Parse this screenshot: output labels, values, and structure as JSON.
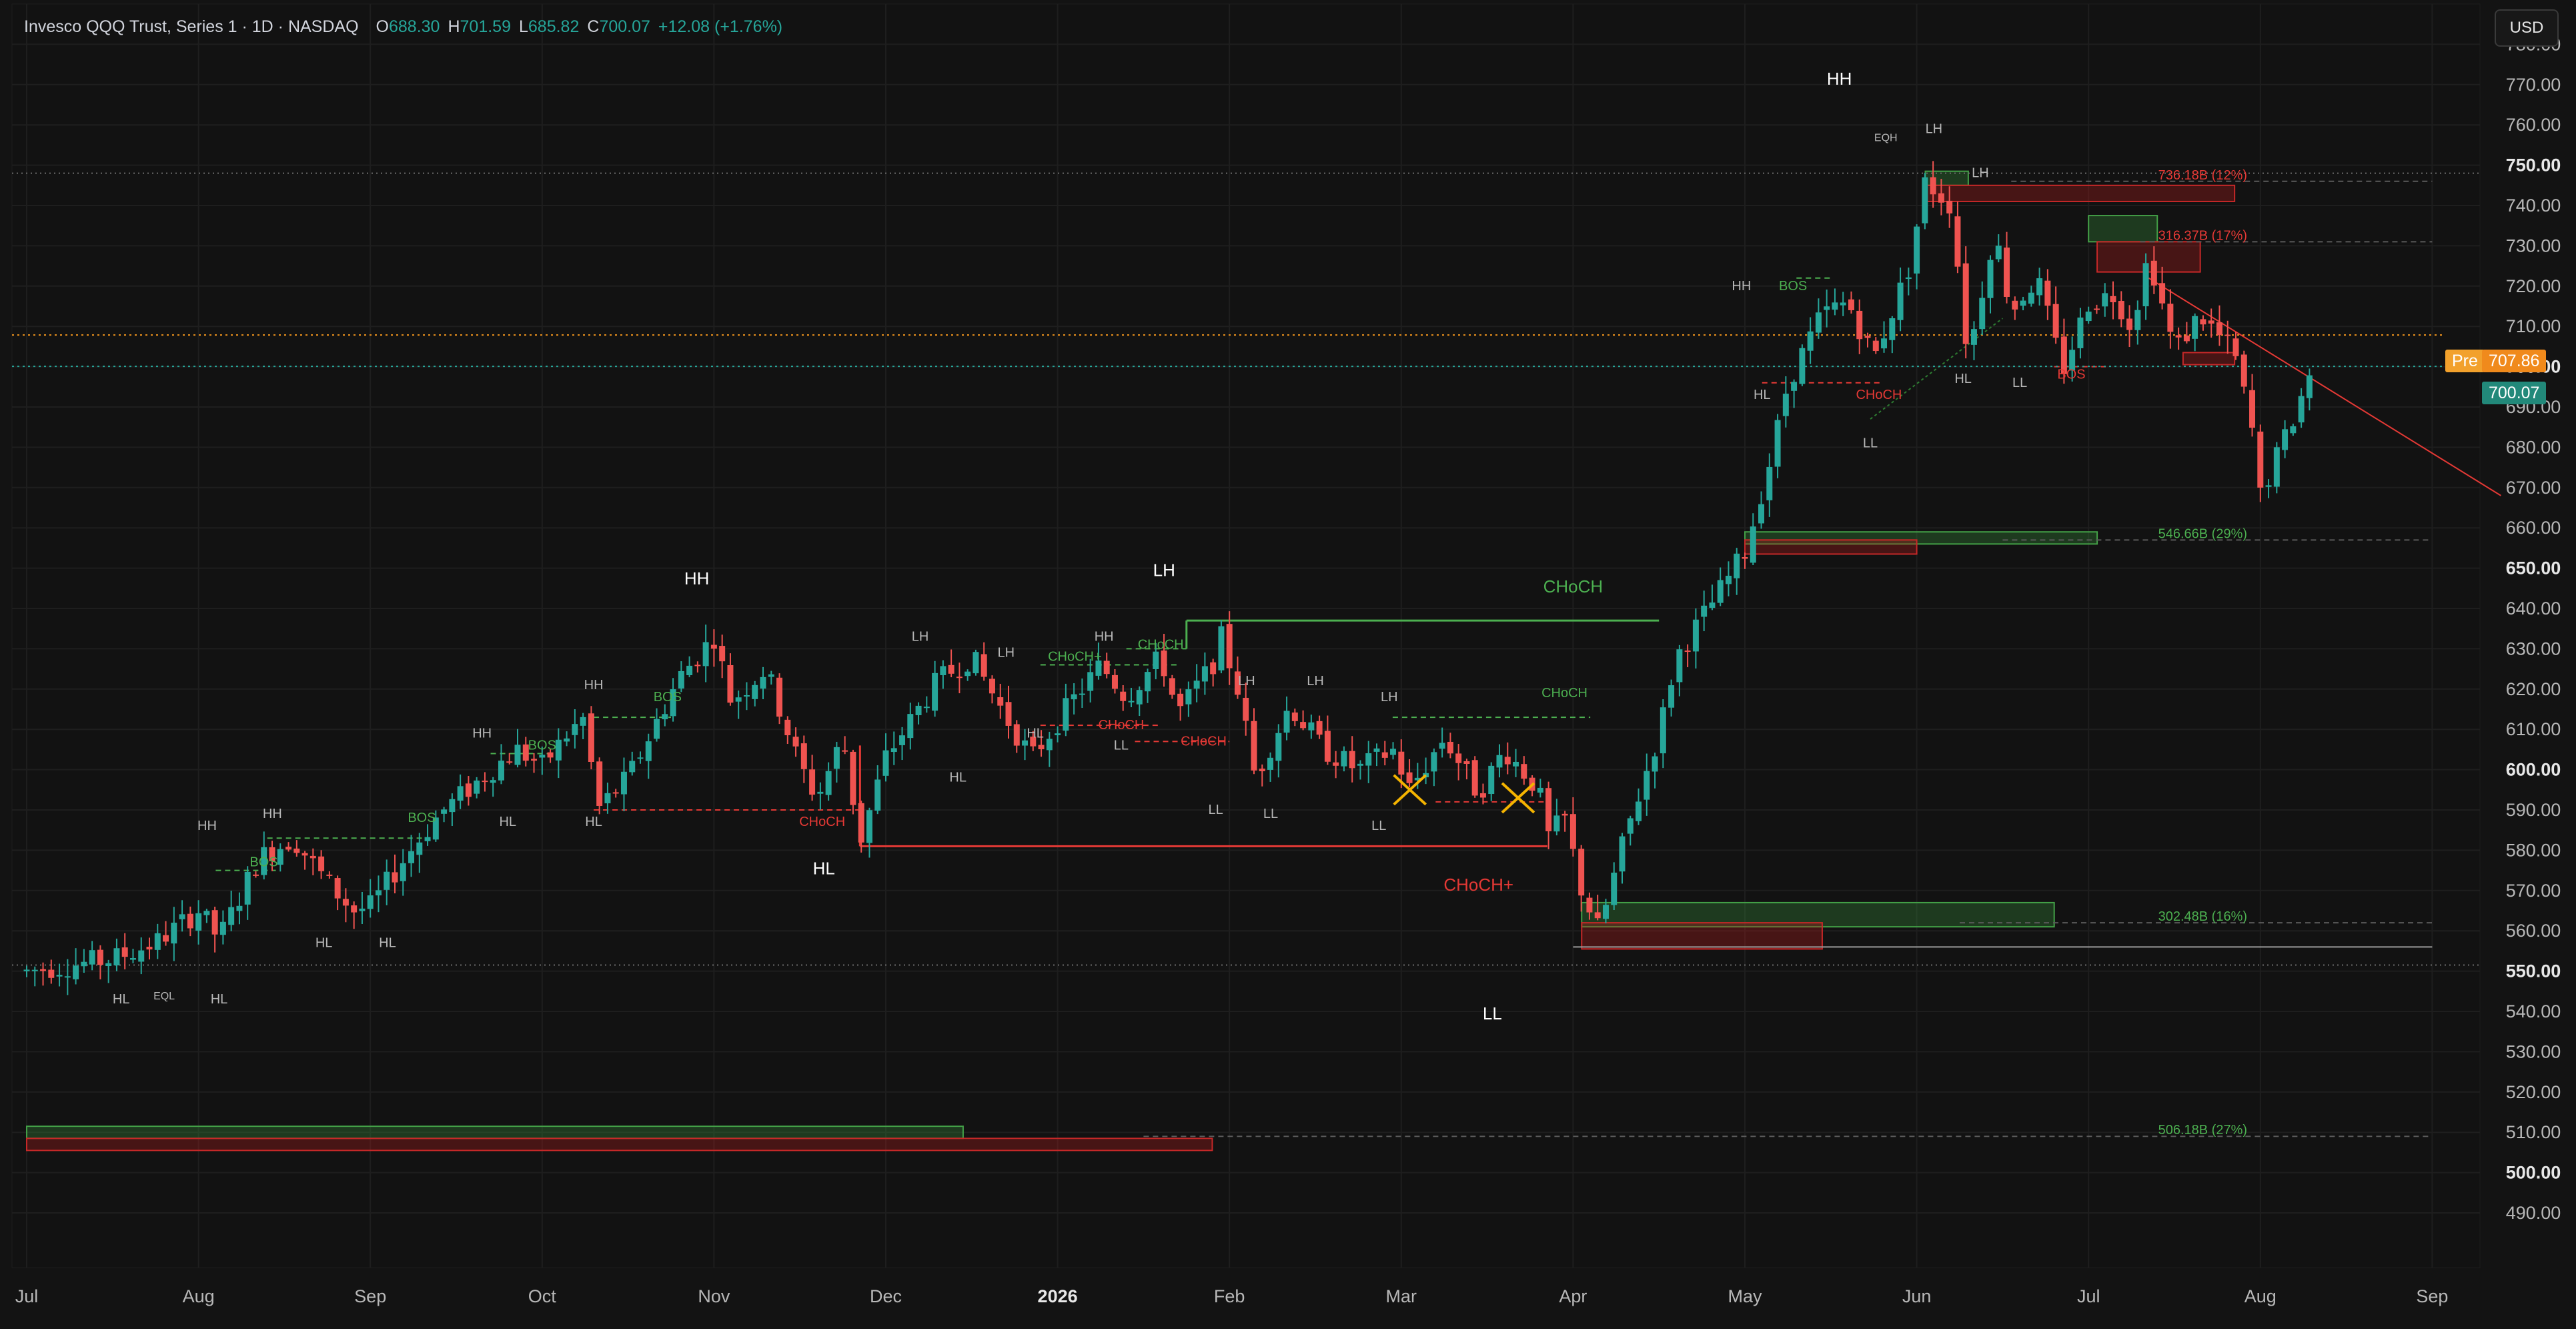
{
  "header": {
    "symbol": "Invesco QQQ Trust, Series 1 · 1D · NASDAQ",
    "open_label": "O",
    "open": "688.30",
    "high_label": "H",
    "high": "701.59",
    "low_label": "L",
    "low": "685.82",
    "close_label": "C",
    "close": "700.07",
    "change": "+12.08 (+1.76%)"
  },
  "currency_button": "USD",
  "markers": {
    "pre_label": "Pre",
    "pre_value": "707.86",
    "last_value": "700.07"
  },
  "colors": {
    "background": "#131313",
    "up": "#26a69a",
    "down": "#ef5350",
    "grid": "#1e1e1e",
    "pre": "#f0941d",
    "structure_bull": "#4caf50",
    "structure_bear": "#e53935"
  },
  "chart_data": {
    "type": "candlestick",
    "y_range": [
      482,
      788
    ],
    "y_ticks": [
      {
        "v": 490,
        "t": "490.00",
        "b": false
      },
      {
        "v": 500,
        "t": "500.00",
        "b": true
      },
      {
        "v": 510,
        "t": "510.00",
        "b": false
      },
      {
        "v": 520,
        "t": "520.00",
        "b": false
      },
      {
        "v": 530,
        "t": "530.00",
        "b": false
      },
      {
        "v": 540,
        "t": "540.00",
        "b": false
      },
      {
        "v": 550,
        "t": "550.00",
        "b": true
      },
      {
        "v": 560,
        "t": "560.00",
        "b": false
      },
      {
        "v": 570,
        "t": "570.00",
        "b": false
      },
      {
        "v": 580,
        "t": "580.00",
        "b": false
      },
      {
        "v": 590,
        "t": "590.00",
        "b": false
      },
      {
        "v": 600,
        "t": "600.00",
        "b": true
      },
      {
        "v": 610,
        "t": "610.00",
        "b": false
      },
      {
        "v": 620,
        "t": "620.00",
        "b": false
      },
      {
        "v": 630,
        "t": "630.00",
        "b": false
      },
      {
        "v": 640,
        "t": "640.00",
        "b": false
      },
      {
        "v": 650,
        "t": "650.00",
        "b": true
      },
      {
        "v": 660,
        "t": "660.00",
        "b": false
      },
      {
        "v": 670,
        "t": "670.00",
        "b": false
      },
      {
        "v": 680,
        "t": "680.00",
        "b": false
      },
      {
        "v": 690,
        "t": "690.00",
        "b": false
      },
      {
        "v": 700,
        "t": "700.00",
        "b": true
      },
      {
        "v": 710,
        "t": "710.00",
        "b": false
      },
      {
        "v": 720,
        "t": "720.00",
        "b": false
      },
      {
        "v": 730,
        "t": "730.00",
        "b": false
      },
      {
        "v": 740,
        "t": "740.00",
        "b": false
      },
      {
        "v": 750,
        "t": "750.00",
        "b": true
      },
      {
        "v": 760,
        "t": "760.00",
        "b": false
      },
      {
        "v": 770,
        "t": "770.00",
        "b": false
      },
      {
        "v": 780,
        "t": "780.00",
        "b": false
      }
    ],
    "x_range": [
      0,
      14.4
    ],
    "x_ticks": [
      {
        "i": 0,
        "t": "Jul",
        "b": false
      },
      {
        "i": 1,
        "t": "Aug",
        "b": false
      },
      {
        "i": 2,
        "t": "Sep",
        "b": false
      },
      {
        "i": 3,
        "t": "Oct",
        "b": false
      },
      {
        "i": 4,
        "t": "Nov",
        "b": false
      },
      {
        "i": 5,
        "t": "Dec",
        "b": false
      },
      {
        "i": 6,
        "t": "2026",
        "b": true
      },
      {
        "i": 7,
        "t": "Feb",
        "b": false
      },
      {
        "i": 8,
        "t": "Mar",
        "b": false
      },
      {
        "i": 9,
        "t": "Apr",
        "b": false
      },
      {
        "i": 10,
        "t": "May",
        "b": false
      },
      {
        "i": 11,
        "t": "Jun",
        "b": false
      },
      {
        "i": 12,
        "t": "Jul",
        "b": false
      },
      {
        "i": 13,
        "t": "Aug",
        "b": false
      },
      {
        "i": 14,
        "t": "Sep",
        "b": false
      }
    ],
    "waypoints": [
      [
        0.0,
        550
      ],
      [
        0.5,
        553
      ],
      [
        0.75,
        557
      ],
      [
        1.0,
        565
      ],
      [
        1.12,
        558
      ],
      [
        1.35,
        578
      ],
      [
        1.55,
        583
      ],
      [
        1.75,
        572
      ],
      [
        1.9,
        565
      ],
      [
        2.0,
        566
      ],
      [
        2.2,
        578
      ],
      [
        2.4,
        589
      ],
      [
        2.65,
        598
      ],
      [
        2.85,
        605
      ],
      [
        3.0,
        601
      ],
      [
        3.15,
        609
      ],
      [
        3.25,
        613
      ],
      [
        3.32,
        590
      ],
      [
        3.5,
        598
      ],
      [
        3.8,
        623
      ],
      [
        4.0,
        633
      ],
      [
        4.1,
        617
      ],
      [
        4.3,
        625
      ],
      [
        4.5,
        601
      ],
      [
        4.6,
        593
      ],
      [
        4.75,
        608
      ],
      [
        4.85,
        582
      ],
      [
        5.0,
        603
      ],
      [
        5.3,
        622
      ],
      [
        5.5,
        628
      ],
      [
        5.7,
        613
      ],
      [
        5.85,
        603
      ],
      [
        6.05,
        615
      ],
      [
        6.25,
        626
      ],
      [
        6.4,
        618
      ],
      [
        6.6,
        628
      ],
      [
        6.7,
        614
      ],
      [
        6.9,
        626
      ],
      [
        6.95,
        633
      ],
      [
        7.05,
        620
      ],
      [
        7.15,
        598
      ],
      [
        7.35,
        616
      ],
      [
        7.55,
        605
      ],
      [
        7.75,
        600
      ],
      [
        7.95,
        605
      ],
      [
        8.05,
        595
      ],
      [
        8.25,
        608
      ],
      [
        8.45,
        594
      ],
      [
        8.6,
        605
      ],
      [
        8.8,
        595
      ],
      [
        8.85,
        583
      ],
      [
        8.95,
        588
      ],
      [
        9.05,
        570
      ],
      [
        9.15,
        560
      ],
      [
        9.3,
        583
      ],
      [
        9.5,
        609
      ],
      [
        9.6,
        628
      ],
      [
        9.85,
        644
      ],
      [
        10.0,
        654
      ],
      [
        10.15,
        677
      ],
      [
        10.25,
        696
      ],
      [
        10.45,
        713
      ],
      [
        10.6,
        716
      ],
      [
        10.75,
        702
      ],
      [
        10.95,
        724
      ],
      [
        11.05,
        746
      ],
      [
        11.2,
        740
      ],
      [
        11.3,
        702
      ],
      [
        11.45,
        734
      ],
      [
        11.55,
        714
      ],
      [
        11.7,
        722
      ],
      [
        11.85,
        699
      ],
      [
        12.0,
        716
      ],
      [
        12.15,
        718
      ],
      [
        12.25,
        710
      ],
      [
        12.35,
        728
      ],
      [
        12.5,
        704
      ],
      [
        12.65,
        713
      ],
      [
        12.85,
        703
      ],
      [
        12.95,
        685
      ],
      [
        13.0,
        668
      ],
      [
        13.2,
        688
      ],
      [
        13.3,
        700.07
      ]
    ],
    "series": [
      {
        "name": "Pre",
        "value": 707.86
      },
      {
        "name": "Last",
        "value": 700.07
      }
    ],
    "structure_labels": [
      {
        "t": "HH",
        "x": 1.05,
        "y": 585,
        "c": "w",
        "s": "s"
      },
      {
        "t": "HH",
        "x": 1.43,
        "y": 588,
        "c": "w",
        "s": "s"
      },
      {
        "t": "HL",
        "x": 0.55,
        "y": 542,
        "c": "w",
        "s": "s"
      },
      {
        "t": "EQL",
        "x": 0.8,
        "y": 543,
        "c": "w",
        "s": "xs"
      },
      {
        "t": "HL",
        "x": 1.12,
        "y": 542,
        "c": "w",
        "s": "s"
      },
      {
        "t": "BOS",
        "x": 1.38,
        "y": 576,
        "c": "g",
        "s": "s"
      },
      {
        "t": "HL",
        "x": 1.73,
        "y": 556,
        "c": "w",
        "s": "s"
      },
      {
        "t": "HL",
        "x": 2.1,
        "y": 556,
        "c": "w",
        "s": "s"
      },
      {
        "t": "BOS",
        "x": 2.3,
        "y": 587,
        "c": "g",
        "s": "s"
      },
      {
        "t": "HH",
        "x": 2.65,
        "y": 608,
        "c": "w",
        "s": "s"
      },
      {
        "t": "HL",
        "x": 2.8,
        "y": 586,
        "c": "w",
        "s": "s"
      },
      {
        "t": "BOS",
        "x": 3.0,
        "y": 605,
        "c": "g",
        "s": "s"
      },
      {
        "t": "HH",
        "x": 3.3,
        "y": 620,
        "c": "w",
        "s": "s"
      },
      {
        "t": "HL",
        "x": 3.3,
        "y": 586,
        "c": "w",
        "s": "s"
      },
      {
        "t": "BOS",
        "x": 3.73,
        "y": 617,
        "c": "g",
        "s": "s"
      },
      {
        "t": "HH",
        "x": 3.9,
        "y": 646,
        "c": "w",
        "s": "m"
      },
      {
        "t": "HL",
        "x": 4.64,
        "y": 574,
        "c": "w",
        "s": "m"
      },
      {
        "t": "CHoCH",
        "x": 4.63,
        "y": 586,
        "c": "r",
        "s": "s"
      },
      {
        "t": "HL",
        "x": 5.42,
        "y": 597,
        "c": "w",
        "s": "s"
      },
      {
        "t": "LH",
        "x": 5.2,
        "y": 632,
        "c": "w",
        "s": "s"
      },
      {
        "t": "LH",
        "x": 5.7,
        "y": 628,
        "c": "w",
        "s": "s"
      },
      {
        "t": "HL",
        "x": 5.87,
        "y": 608,
        "c": "w",
        "s": "s"
      },
      {
        "t": "CHoCH+",
        "x": 6.1,
        "y": 627,
        "c": "g",
        "s": "s"
      },
      {
        "t": "HH",
        "x": 6.27,
        "y": 632,
        "c": "w",
        "s": "s"
      },
      {
        "t": "CHoCH",
        "x": 6.6,
        "y": 630,
        "c": "g",
        "s": "s"
      },
      {
        "t": "LH",
        "x": 6.62,
        "y": 648,
        "c": "w",
        "s": "m"
      },
      {
        "t": "CHoCH",
        "x": 6.37,
        "y": 610,
        "c": "r",
        "s": "s"
      },
      {
        "t": "LL",
        "x": 6.37,
        "y": 605,
        "c": "w",
        "s": "s"
      },
      {
        "t": "CHoCH",
        "x": 6.85,
        "y": 606,
        "c": "r",
        "s": "s"
      },
      {
        "t": "LL",
        "x": 6.92,
        "y": 589,
        "c": "w",
        "s": "s"
      },
      {
        "t": "LH",
        "x": 7.1,
        "y": 621,
        "c": "w",
        "s": "s"
      },
      {
        "t": "LL",
        "x": 7.24,
        "y": 588,
        "c": "w",
        "s": "s"
      },
      {
        "t": "LH",
        "x": 7.5,
        "y": 621,
        "c": "w",
        "s": "s"
      },
      {
        "t": "LL",
        "x": 7.87,
        "y": 585,
        "c": "w",
        "s": "s"
      },
      {
        "t": "LH",
        "x": 7.93,
        "y": 617,
        "c": "w",
        "s": "s"
      },
      {
        "t": "CHoCH+",
        "x": 8.45,
        "y": 570,
        "c": "r",
        "s": "m"
      },
      {
        "t": "LL",
        "x": 8.53,
        "y": 538,
        "c": "w",
        "s": "m"
      },
      {
        "t": "CHoCH",
        "x": 8.95,
        "y": 618,
        "c": "g",
        "s": "s"
      },
      {
        "t": "CHoCH",
        "x": 9.0,
        "y": 644,
        "c": "g",
        "s": "m"
      },
      {
        "t": "HH",
        "x": 10.55,
        "y": 770,
        "c": "w",
        "s": "m"
      },
      {
        "t": "HH",
        "x": 9.98,
        "y": 719,
        "c": "w",
        "s": "s"
      },
      {
        "t": "BOS",
        "x": 10.28,
        "y": 719,
        "c": "g",
        "s": "s"
      },
      {
        "t": "HL",
        "x": 10.1,
        "y": 692,
        "c": "w",
        "s": "s"
      },
      {
        "t": "EQH",
        "x": 10.82,
        "y": 756,
        "c": "w",
        "s": "xs"
      },
      {
        "t": "LH",
        "x": 11.1,
        "y": 758,
        "c": "w",
        "s": "s"
      },
      {
        "t": "LH",
        "x": 11.37,
        "y": 747,
        "c": "w",
        "s": "s"
      },
      {
        "t": "CHoCH",
        "x": 10.78,
        "y": 692,
        "c": "r",
        "s": "s"
      },
      {
        "t": "LL",
        "x": 10.73,
        "y": 680,
        "c": "w",
        "s": "s"
      },
      {
        "t": "HL",
        "x": 11.27,
        "y": 696,
        "c": "w",
        "s": "s"
      },
      {
        "t": "LL",
        "x": 11.6,
        "y": 695,
        "c": "w",
        "s": "s"
      },
      {
        "t": "BOS",
        "x": 11.9,
        "y": 697,
        "c": "r",
        "s": "s"
      }
    ],
    "levels": [
      {
        "t": "736.18B (12%)",
        "x": 12.25,
        "y": 746,
        "c": "r",
        "x0": 11.55,
        "x1": 14.0
      },
      {
        "t": "316.37B (17%)",
        "x": 12.25,
        "y": 731,
        "c": "r",
        "x0": 12.3,
        "x1": 14.0
      },
      {
        "t": "546.66B (29%)",
        "x": 12.25,
        "y": 657,
        "c": "g",
        "x0": 11.5,
        "x1": 14.0
      },
      {
        "t": "302.48B (16%)",
        "x": 12.25,
        "y": 562,
        "c": "g",
        "x0": 11.25,
        "x1": 14.0
      },
      {
        "t": "506.18B (27%)",
        "x": 12.25,
        "y": 509,
        "c": "g",
        "x0": 6.5,
        "x1": 14.0
      }
    ]
  }
}
